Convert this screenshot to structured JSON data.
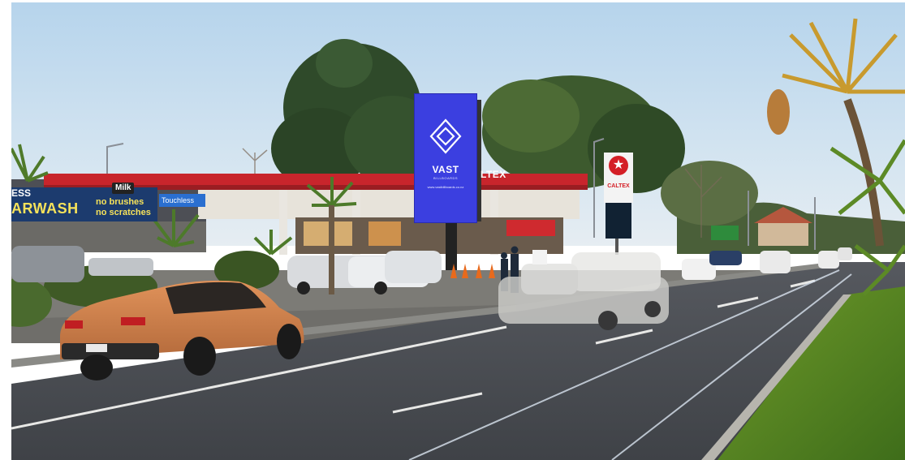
{
  "billboard": {
    "brand": "VAST",
    "sub": "BILLBOARDS",
    "url": "www.vastbillboards.co.nz",
    "color": "#3b3fe0"
  },
  "carwash": {
    "top": "ESS",
    "word": "ARWASH",
    "milk": "Milk",
    "line1": "no brushes",
    "line2": "no scratches",
    "touchless": "Touchless"
  },
  "caltex": {
    "canopy": "LTEX",
    "pole": "CALTEX",
    "brand_color": "#d41f26"
  }
}
